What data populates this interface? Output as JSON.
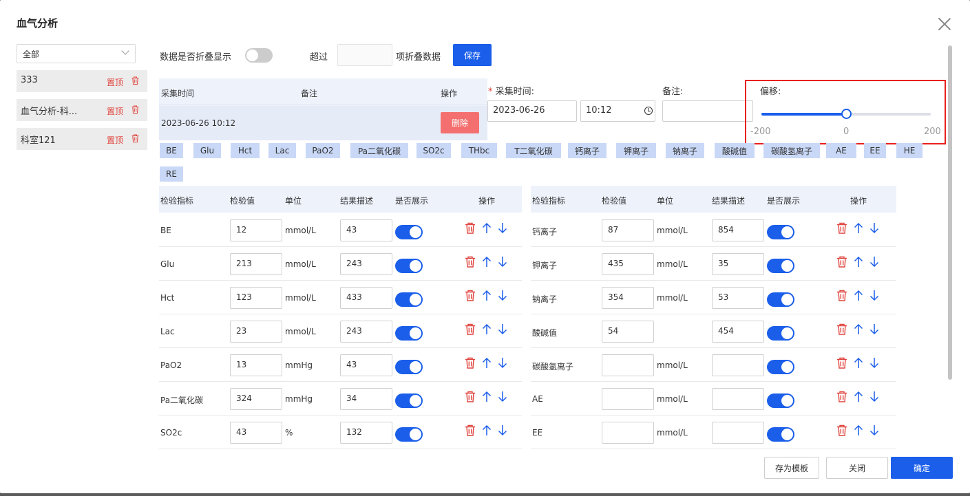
{
  "dialog": {
    "title": "血气分析"
  },
  "sidebar": {
    "select_value": "全部",
    "items": [
      {
        "label": "333",
        "pin": "置顶"
      },
      {
        "label": "血气分析-科...",
        "pin": "置顶"
      },
      {
        "label": "科室121",
        "pin": "置顶"
      }
    ]
  },
  "toolbar": {
    "fold_label": "数据是否折叠显示",
    "over_label": "超过",
    "over_value": "",
    "fold_suffix": "项折叠数据",
    "save_label": "保存"
  },
  "records": {
    "headers": [
      "采集时间",
      "备注",
      "操作"
    ],
    "rows": [
      {
        "time": "2023-06-26 10:12",
        "note": "",
        "delete_label": "删除"
      }
    ]
  },
  "form": {
    "required_mark": "*",
    "time_label": "采集时间:",
    "date_value": "2023-06-26",
    "time_value": "10:12",
    "note_label": "备注:",
    "note_value": "",
    "offset_label": "偏移:",
    "offset_min": "-200",
    "offset_mid": "0",
    "offset_max": "200",
    "offset_value": 0,
    "offset_range": [
      -200,
      200
    ]
  },
  "tags": [
    "BE",
    "Glu",
    "Hct",
    "Lac",
    "PaO2",
    "Pa二氧化碳",
    "SO2c",
    "THbc",
    "T二氧化碳",
    "钙离子",
    "钾离子",
    "钠离子",
    "酸碱值",
    "碳酸氢离子",
    "AE",
    "EE",
    "HE",
    "RE"
  ],
  "grid": {
    "headers": [
      "检验指标",
      "检验值",
      "单位",
      "结果描述",
      "是否展示",
      "操作"
    ],
    "left": [
      {
        "name": "BE",
        "value": "12",
        "unit": "mmol/L",
        "desc": "43"
      },
      {
        "name": "Glu",
        "value": "213",
        "unit": "mmol/L",
        "desc": "243"
      },
      {
        "name": "Hct",
        "value": "123",
        "unit": "mmol/L",
        "desc": "433"
      },
      {
        "name": "Lac",
        "value": "23",
        "unit": "mmol/L",
        "desc": "243"
      },
      {
        "name": "PaO2",
        "value": "13",
        "unit": "mmHg",
        "desc": "43"
      },
      {
        "name": "Pa二氧化碳",
        "value": "324",
        "unit": "mmHg",
        "desc": "34"
      },
      {
        "name": "SO2c",
        "value": "43",
        "unit": "%",
        "desc": "132"
      }
    ],
    "right": [
      {
        "name": "钙离子",
        "value": "87",
        "unit": "mmol/L",
        "desc": "854"
      },
      {
        "name": "钾离子",
        "value": "435",
        "unit": "mmol/L",
        "desc": "35"
      },
      {
        "name": "钠离子",
        "value": "354",
        "unit": "mmol/L",
        "desc": "53"
      },
      {
        "name": "酸碱值",
        "value": "54",
        "unit": "",
        "desc": "454"
      },
      {
        "name": "碳酸氢离子",
        "value": "",
        "unit": "mmol/L",
        "desc": ""
      },
      {
        "name": "AE",
        "value": "",
        "unit": "mmol/L",
        "desc": ""
      },
      {
        "name": "EE",
        "value": "",
        "unit": "mmol/L",
        "desc": ""
      }
    ]
  },
  "footer": {
    "template_label": "存为模板",
    "close_label": "关闭",
    "confirm_label": "确定"
  },
  "colors": {
    "primary": "#1a5eea",
    "danger": "#e0443e",
    "highlight": "#e8201c"
  }
}
